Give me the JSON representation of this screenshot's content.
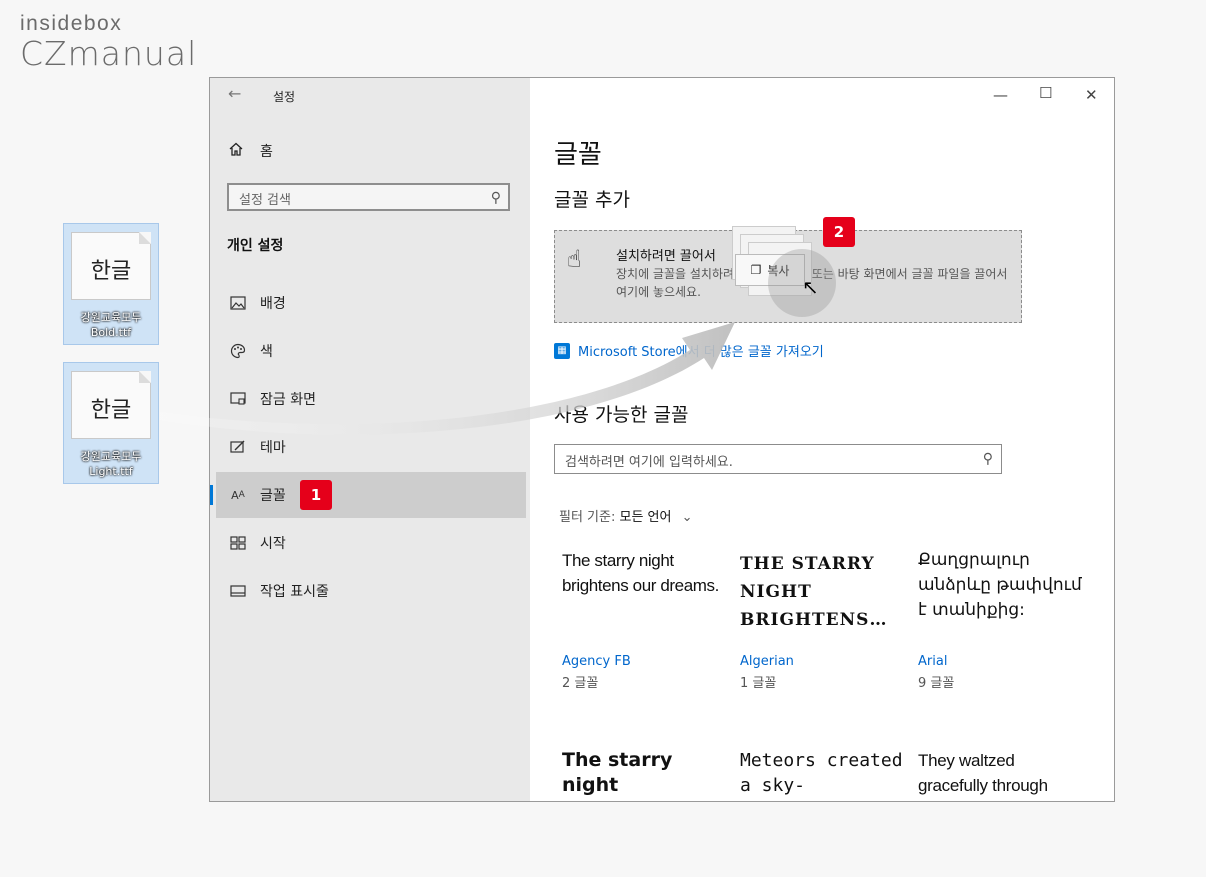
{
  "brand": {
    "top": "insidebox",
    "bottom": "CZmanual"
  },
  "desktop_files": [
    {
      "glyph": "한글",
      "name": "강원교육모두 Bold.ttf"
    },
    {
      "glyph": "한글",
      "name": "강원교육모두 Light.ttf"
    }
  ],
  "window": {
    "title": "설정",
    "back_icon": "arrow-left-icon"
  },
  "sidebar": {
    "home": "홈",
    "search_placeholder": "설정 검색",
    "section": "개인 설정",
    "items": [
      {
        "label": "배경",
        "icon": "image-icon"
      },
      {
        "label": "색",
        "icon": "palette-icon"
      },
      {
        "label": "잠금 화면",
        "icon": "lock-screen-icon"
      },
      {
        "label": "테마",
        "icon": "theme-icon"
      },
      {
        "label": "글꼴",
        "icon": "font-icon",
        "active": true
      },
      {
        "label": "시작",
        "icon": "start-icon"
      },
      {
        "label": "작업 표시줄",
        "icon": "taskbar-icon"
      }
    ]
  },
  "badges": {
    "one": "1",
    "two": "2"
  },
  "main": {
    "title": "글꼴",
    "add_heading": "글꼴 추가",
    "drop_title": "설치하려면 끌어서",
    "drop_desc": "장치에 글꼴을 설치하려면 파일 탐색기 또는 바탕 화면에서 글꼴 파일을 끌어서 여기에 놓으세요.",
    "copy_tooltip": "복사",
    "store_link": "Microsoft Store에서 더 많은 글꼴 가져오기",
    "available_heading": "사용 가능한 글꼴",
    "search_placeholder": "검색하려면 여기에 입력하세요.",
    "filter_label": "필터 기준:",
    "filter_value": "모든 언어",
    "fonts": [
      {
        "sample": "The starry night brightens our dreams.",
        "name": "Agency FB",
        "count": "2 글꼴"
      },
      {
        "sample": "THE STARRY NIGHT BRIGHTENS…",
        "name": "Algerian",
        "count": "1 글꼴"
      },
      {
        "sample": "Քաղցրալուր անձրևը թափվում է տանիքից:",
        "name": "Arial",
        "count": "9 글꼴"
      },
      {
        "sample": "The starry night",
        "name": "",
        "count": ""
      },
      {
        "sample": "Meteors created a sky-",
        "name": "",
        "count": ""
      },
      {
        "sample": "They waltzed gracefully through",
        "name": "",
        "count": ""
      }
    ]
  },
  "colors": {
    "accent": "#0078d7",
    "badge": "#e5001a",
    "link": "#0066cc"
  }
}
